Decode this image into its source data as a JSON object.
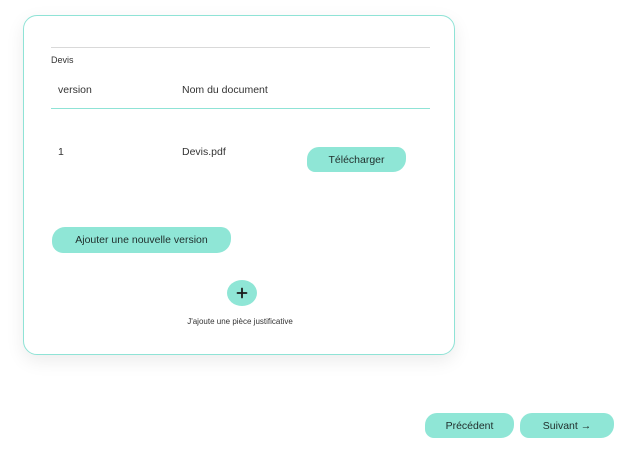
{
  "quote": {
    "section_label": "Devis",
    "columns": {
      "version": "version",
      "document_name": "Nom du document"
    },
    "rows": [
      {
        "version": "1",
        "document_name": "Devis.pdf",
        "download_label": "Télécharger"
      }
    ],
    "add_version_label": "Ajouter une nouvelle version",
    "add_attachment_caption": "J'ajoute une pièce justificative"
  },
  "navigation": {
    "previous_label": "Précédent",
    "next_label": "Suivant →"
  },
  "colors": {
    "accent": "#8fe6d6",
    "card_border": "#8fe3d6"
  },
  "icons": {
    "add": "plus-icon"
  }
}
